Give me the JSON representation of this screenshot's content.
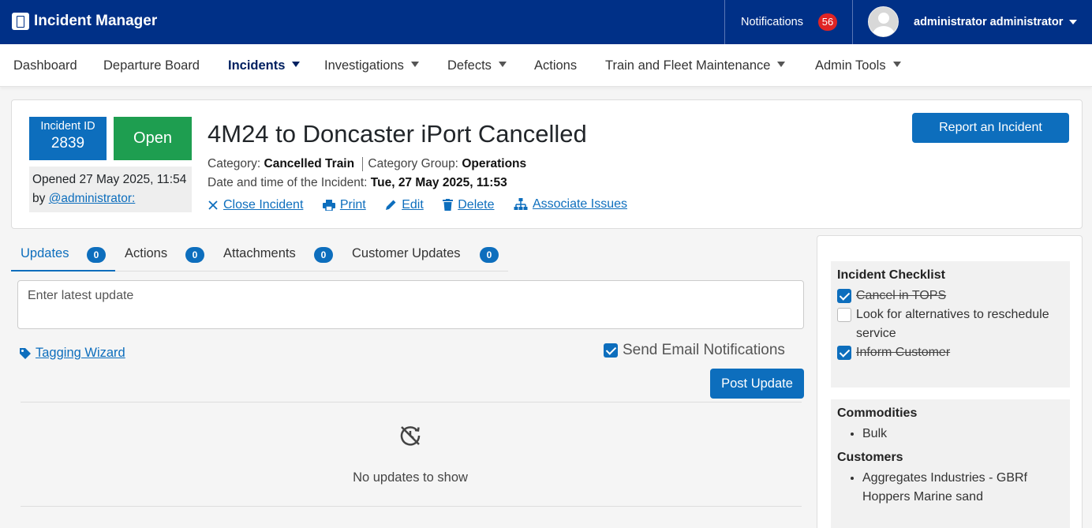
{
  "app": {
    "title": "Incident Manager"
  },
  "topbar": {
    "notifications_label": "Notifications",
    "notifications_count": "56",
    "user_name": "administrator administrator"
  },
  "nav": {
    "items": [
      {
        "label": "Dashboard",
        "dropdown": false
      },
      {
        "label": "Departure Board",
        "dropdown": false
      },
      {
        "label": "Incidents",
        "dropdown": true,
        "active": true
      },
      {
        "label": "Investigations",
        "dropdown": true
      },
      {
        "label": "Defects",
        "dropdown": true
      },
      {
        "label": "Actions",
        "dropdown": false
      },
      {
        "label": "Train and Fleet Maintenance",
        "dropdown": true
      },
      {
        "label": "Admin Tools",
        "dropdown": true
      }
    ]
  },
  "incident": {
    "id_label": "Incident ID",
    "id": "2839",
    "status": "Open",
    "opened_text": "Opened 27 May 2025, 11:54 by",
    "opened_by": "@administrator:",
    "title": "4M24 to Doncaster iPort Cancelled",
    "category_label": "Category:",
    "category": "Cancelled Train",
    "category_group_label": "Category Group:",
    "category_group": "Operations",
    "datetime_label": "Date and time of the Incident:",
    "datetime": "Tue, 27 May 2025, 11:53",
    "actions": {
      "close": "Close Incident",
      "print": "Print",
      "edit": "Edit",
      "delete": "Delete",
      "associate": "Associate Issues"
    },
    "report_button": "Report an Incident"
  },
  "tabs": [
    {
      "label": "Updates",
      "count": "0",
      "active": true
    },
    {
      "label": "Actions",
      "count": "0"
    },
    {
      "label": "Attachments",
      "count": "0"
    },
    {
      "label": "Customer Updates",
      "count": "0"
    }
  ],
  "updates": {
    "placeholder": "Enter latest update",
    "tagging_wizard": "Tagging Wizard",
    "send_email_label": "Send Email Notifications",
    "send_email_checked": true,
    "post_button": "Post Update",
    "empty_text": "No updates to show"
  },
  "sidebar": {
    "checklist_title": "Incident Checklist",
    "checklist": [
      {
        "label": "Cancel in TOPS",
        "checked": true
      },
      {
        "label": "Look for alternatives to reschedule service",
        "checked": false
      },
      {
        "label": "Inform Customer",
        "checked": true
      }
    ],
    "commodities_title": "Commodities",
    "commodities": [
      "Bulk"
    ],
    "customers_title": "Customers",
    "customers": [
      "Aggregates Industries - GBRf Hoppers Marine sand"
    ]
  },
  "colors": {
    "topbar": "#003087",
    "primary": "#0d6ebd",
    "open_status": "#1e9e50",
    "notification_badge": "#e02424"
  }
}
